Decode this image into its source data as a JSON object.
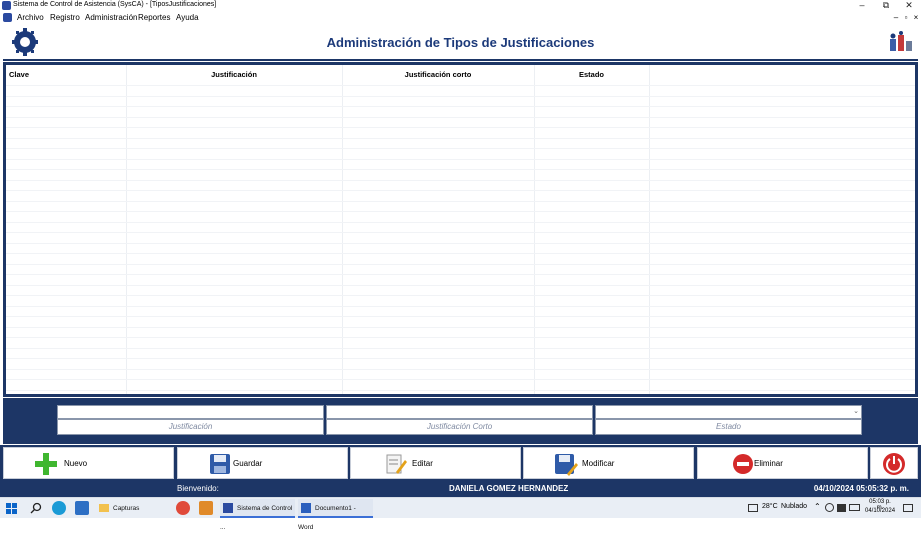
{
  "window": {
    "title": "Sistema de Control de Asistencia (SysCA) - [TiposJustificaciones]",
    "minimize": "–",
    "restore": "⧉",
    "close": "✕"
  },
  "menu": {
    "items": [
      "Archivo",
      "Registro",
      "Administración",
      "Reportes",
      "Ayuda"
    ],
    "mdi_min": "–",
    "mdi_restore": "▫",
    "mdi_close": "×"
  },
  "header": {
    "title": "Administración de Tipos de Justificaciones"
  },
  "grid": {
    "columns": [
      "Clave",
      "Justificación",
      "Justificación corto",
      "Estado"
    ],
    "rows": []
  },
  "form": {
    "justificacion_placeholder": "Justificación",
    "justificacion_corto_placeholder": "Justificación  Corto",
    "estado_placeholder": "Estado",
    "estado_value": ""
  },
  "buttons": {
    "nuevo": "Nuevo",
    "guardar": "Guardar",
    "editar": "Editar",
    "modificar": "Modificar",
    "eliminar": "Eliminar"
  },
  "status": {
    "welcome_label": "Bienvenido:",
    "user_name": "DANIELA GOMEZ HERNANDEZ",
    "datetime": "04/10/2024 05:05:32 p. m."
  },
  "taskbar": {
    "apps": [
      {
        "label": "Capturas",
        "icon": "folder-icon"
      },
      {
        "label": "Sistema de Control ...",
        "icon": "sysca-icon"
      },
      {
        "label": "Documento1 - Word",
        "icon": "word-icon"
      }
    ],
    "weather_temp": "28°C",
    "weather_text": "Nublado",
    "clock_time": "05:03 p. m.",
    "clock_date": "04/10/2024"
  },
  "colors": {
    "navy": "#1d3666",
    "title_blue": "#1c3a7a",
    "green": "#3fb62f",
    "red": "#d42a2a"
  }
}
